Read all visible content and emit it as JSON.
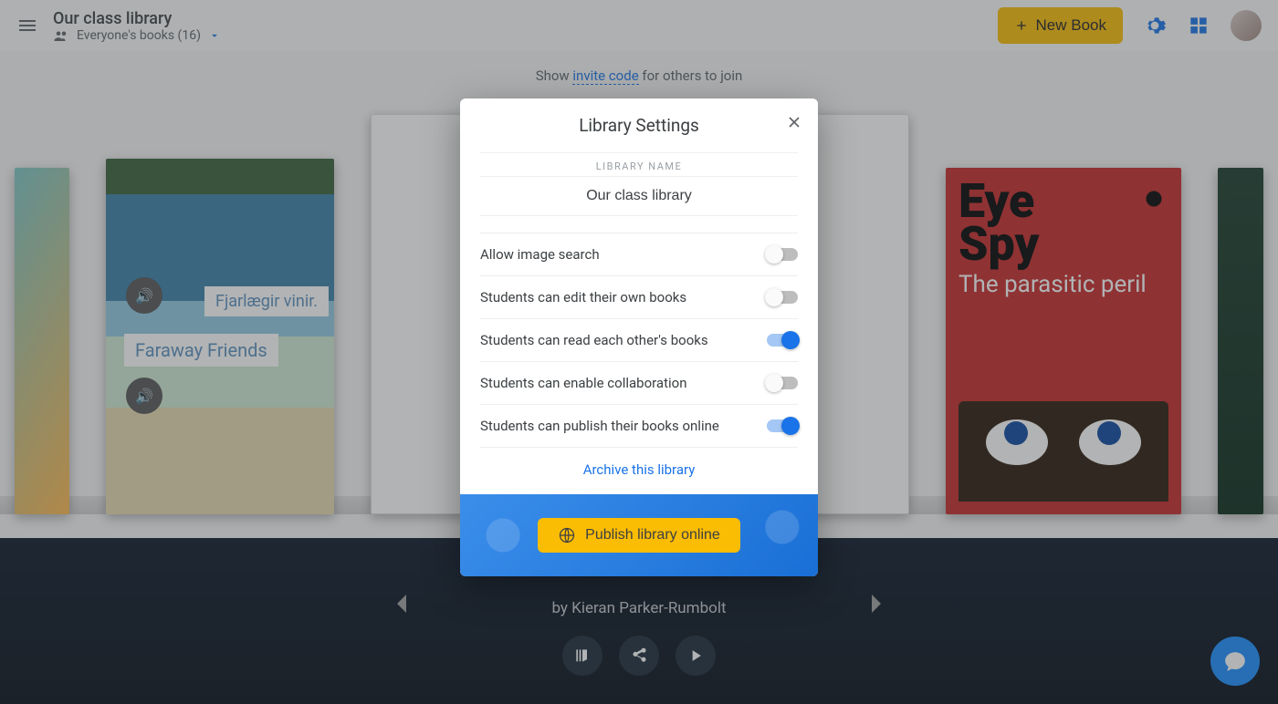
{
  "header": {
    "title": "Our class library",
    "subtitle": "Everyone's books (16)",
    "new_book_label": "New Book"
  },
  "invite": {
    "prefix": "Show ",
    "link": "invite code",
    "suffix": " for others to join"
  },
  "shelf": {
    "faraway": {
      "label1": "Fjarlægir vinir.",
      "label2": "Faraway Friends"
    },
    "eye_spy": {
      "line1": "Eye",
      "line2": "Spy",
      "subtitle": "The parasitic peril"
    }
  },
  "bottom": {
    "author": "by Kieran Parker-Rumbolt"
  },
  "modal": {
    "title": "Library Settings",
    "section_label": "LIBRARY NAME",
    "library_name_value": "Our class library",
    "toggles": [
      {
        "label": "Allow image search",
        "on": false
      },
      {
        "label": "Students can edit their own books",
        "on": false
      },
      {
        "label": "Students can read each other's books",
        "on": true
      },
      {
        "label": "Students can enable collaboration",
        "on": false
      },
      {
        "label": "Students can publish their books online",
        "on": true
      }
    ],
    "archive_label": "Archive this library",
    "publish_label": "Publish library online"
  },
  "colors": {
    "accent": "#1a73e8",
    "primary_button": "#fbbc04"
  }
}
